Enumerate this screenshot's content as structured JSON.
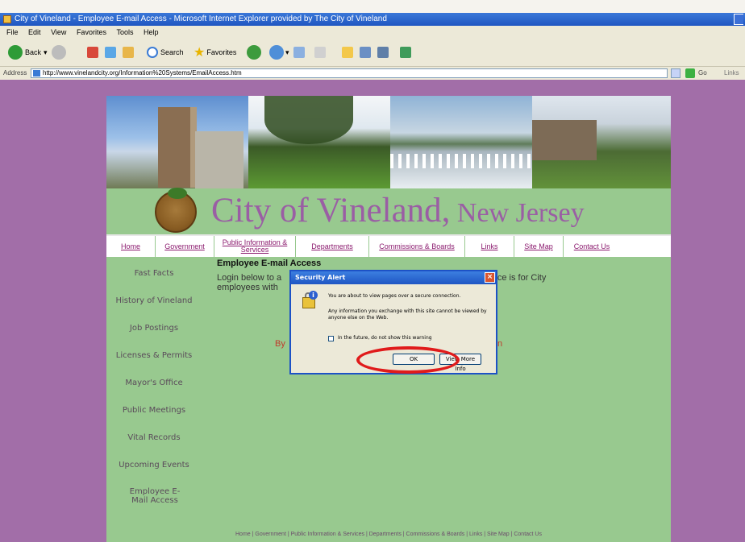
{
  "browser": {
    "window_title": "City of Vineland - Employee E-mail Access - Microsoft Internet Explorer provided by The City of Vineland",
    "menu": [
      "File",
      "Edit",
      "View",
      "Favorites",
      "Tools",
      "Help"
    ],
    "toolbar": {
      "back": "Back",
      "search": "Search",
      "favorites": "Favorites"
    },
    "address_label": "Address",
    "address_url": "http://www.vinelandcity.org/Information%20Systems/EmailAccess.htm",
    "go_label": "Go",
    "links_label": "Links"
  },
  "site": {
    "title_main": "City of Vineland,",
    "title_state": " New Jersey",
    "nav": [
      {
        "label": "Home"
      },
      {
        "label": "Government"
      },
      {
        "label": "Public Information & Services"
      },
      {
        "label": "Departments"
      },
      {
        "label": "Commissions & Boards"
      },
      {
        "label": "Links"
      },
      {
        "label": "Site Map"
      },
      {
        "label": "Contact Us"
      }
    ],
    "left_nav": [
      {
        "label": "Fast Facts"
      },
      {
        "label": "History of Vineland"
      },
      {
        "label": "Job Postings"
      },
      {
        "label": "Licenses & Permits"
      },
      {
        "label": "Mayor's Office"
      },
      {
        "label": "Public Meetings"
      },
      {
        "label": "Vital Records"
      },
      {
        "label": "Upcoming Events"
      },
      {
        "label": "Employee E-Mail Access"
      }
    ],
    "content": {
      "heading": "Employee E-mail Access",
      "body_left": "Login below to a",
      "body_right": "ervice is for City",
      "body_line2": "employees with",
      "red_left": "By",
      "red_right": "n"
    },
    "footer": "Home | Government | Public Information & Services | Departments | Commissions & Boards | Links | Site Map | Contact Us"
  },
  "dialog": {
    "title": "Security Alert",
    "close": "×",
    "message1": "You are about to view pages over a secure connection.",
    "message2": "Any information you exchange with this site cannot be viewed by anyone else on the Web.",
    "checkbox_label": "In the future, do not show this warning",
    "ok_label": "OK",
    "more_info_label": "View More Info"
  },
  "colors": {
    "page_background": "#a26ea8",
    "site_background": "#98c98f",
    "title_purple": "#9a5ea4",
    "nav_link": "#8b1a6e",
    "annotation_red": "#e01b1b"
  }
}
